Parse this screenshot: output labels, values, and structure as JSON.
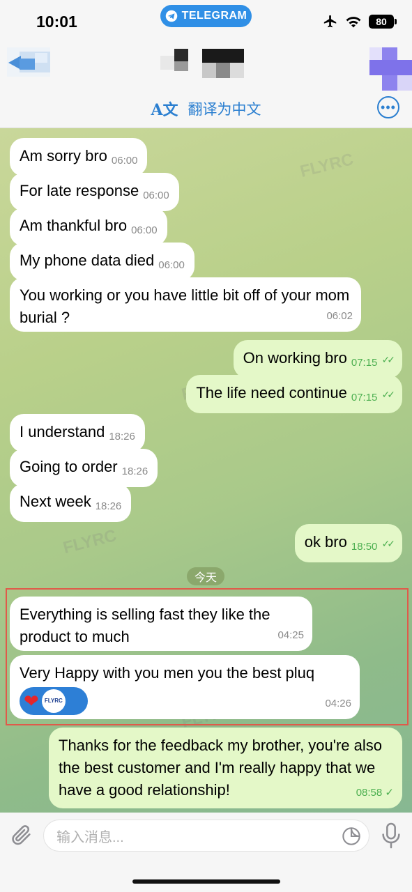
{
  "status": {
    "time": "10:01",
    "app_pill": "TELEGRAM",
    "battery": "80"
  },
  "header": {
    "translate_label": "翻译为中文",
    "translate_icon_text": "A文"
  },
  "messages": [
    {
      "text": "Am sorry bro",
      "time": "06:00"
    },
    {
      "text": "For late response",
      "time": "06:00"
    },
    {
      "text": "Am thankful bro",
      "time": "06:00"
    },
    {
      "text": "My phone data died",
      "time": "06:00"
    },
    {
      "text": "You working or you have little bit off of your mom burial ?",
      "time": "06:02"
    },
    {
      "text": "On working bro",
      "time": "07:15"
    },
    {
      "text": "The life need continue",
      "time": "07:15"
    },
    {
      "text": "I understand",
      "time": "18:26"
    },
    {
      "text": "Going to order",
      "time": "18:26"
    },
    {
      "text": "Next week",
      "time": "18:26"
    },
    {
      "text": "ok bro",
      "time": "18:50"
    },
    {
      "text": "Everything is selling fast they like the product to much",
      "time": "04:25"
    },
    {
      "text": "Very Happy with you men you the best pluq",
      "time": "04:26"
    },
    {
      "text": "Thanks for the feedback my brother, you're also the best customer and I'm really happy that we have a good relationship!",
      "time": "08:58"
    }
  ],
  "date_separator": "今天",
  "reaction": {
    "emoji": "❤",
    "avatar_text": "FLYRC"
  },
  "watermark": "FLYRC",
  "input": {
    "placeholder": "输入消息..."
  },
  "colors": {
    "accent": "#2b7fd0",
    "incoming": "#ffffff",
    "outgoing": "#e4f8c8",
    "highlight": "#e05a4a"
  }
}
